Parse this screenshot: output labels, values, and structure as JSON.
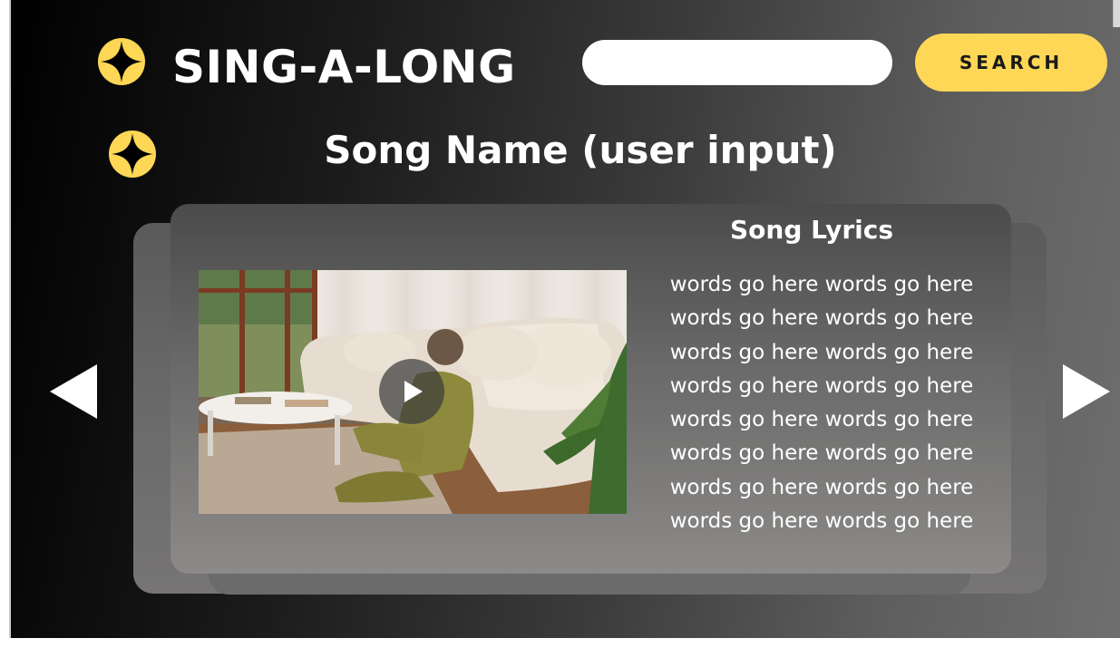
{
  "header": {
    "brand": "SING-A-LONG",
    "logo_icon": "compass-star-icon",
    "search": {
      "value": "",
      "placeholder": ""
    },
    "search_button_label": "SEARCH"
  },
  "song": {
    "icon": "compass-star-icon",
    "title": "Song Name (user input)"
  },
  "video": {
    "thumbnail": "person-sitting-by-sofa-thumbnail",
    "play_icon": "play-icon"
  },
  "lyrics": {
    "heading": "Song Lyrics",
    "lines": [
      "words go here words go here",
      "words go here words go here",
      "words go here words go here",
      "words go here words go here",
      "words go here words go here",
      "words go here words go here",
      "words go here words go here",
      "words go here words go here"
    ]
  },
  "navigation": {
    "prev_icon": "arrow-left-icon",
    "next_icon": "arrow-right-icon"
  },
  "colors": {
    "accent": "#fdd755",
    "text": "#ffffff",
    "background_dark": "#000000",
    "background_light": "#6f6f6f"
  }
}
